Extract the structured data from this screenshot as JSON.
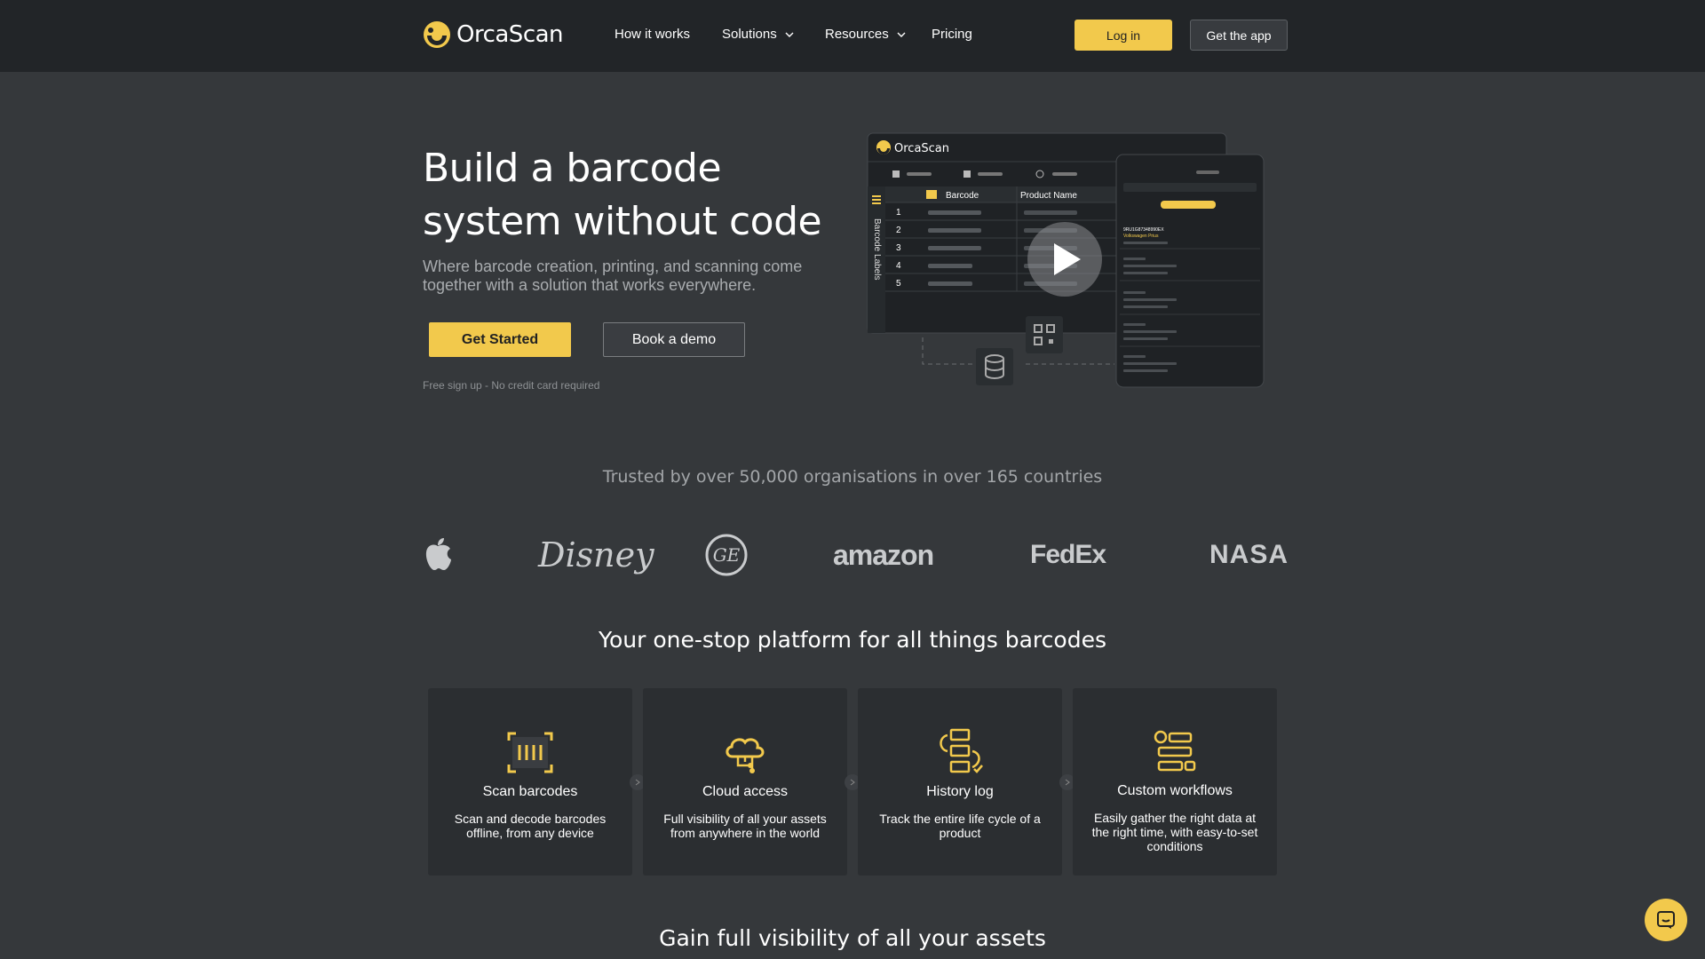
{
  "brand": {
    "name": "OrcaScan",
    "accent": "#f2c94c"
  },
  "nav": {
    "links": [
      {
        "label": "How it works"
      },
      {
        "label": "Solutions"
      },
      {
        "label": "Resources"
      },
      {
        "label": "Pricing"
      }
    ],
    "login_label": "Log in",
    "app_label": "Get the app"
  },
  "hero": {
    "title_line1": "Build a barcode",
    "title_line2": "system without code",
    "subtitle": "Where barcode creation, printing, and scanning come together with a solution that works everywhere.",
    "primary_cta": "Get Started",
    "secondary_cta": "Book a demo",
    "note": "Free sign up - No credit card required"
  },
  "preview": {
    "app_name": "OrcaScan",
    "sidebar_label": "Barcode Labels",
    "columns": [
      "Barcode",
      "Product Name"
    ],
    "rows": [
      "1",
      "2",
      "3",
      "4",
      "5"
    ],
    "mobile_first_code": "9RU1G87348990EX",
    "mobile_first_name": "Volkswagen Prius"
  },
  "trusted": {
    "text": "Trusted by over 50,000 organisations in over 165 countries"
  },
  "logos": [
    "apple-logo",
    "disney-logo",
    "ge-logo",
    "amazon-logo",
    "fedex-logo",
    "nasa-logo"
  ],
  "logo_text": {
    "disney": "Disney",
    "amazon": "amazon",
    "fedex": "FedEx",
    "nasa": "NASA"
  },
  "platform": {
    "title": "Your one-stop platform for all things barcodes",
    "cards": [
      {
        "title": "Scan barcodes",
        "desc": "Scan and decode barcodes offline, from any device",
        "icon": "scan-barcode-icon"
      },
      {
        "title": "Cloud access",
        "desc": "Full visibility of all your assets from anywhere in the world",
        "icon": "cloud-icon"
      },
      {
        "title": "History log",
        "desc": "Track the entire life cycle of a product",
        "icon": "history-icon"
      },
      {
        "title": "Custom workflows",
        "desc": "Easily gather the right data at the right time, with easy-to-set conditions",
        "icon": "workflow-icon"
      }
    ]
  },
  "bottom": {
    "title": "Gain full visibility of all your assets"
  }
}
